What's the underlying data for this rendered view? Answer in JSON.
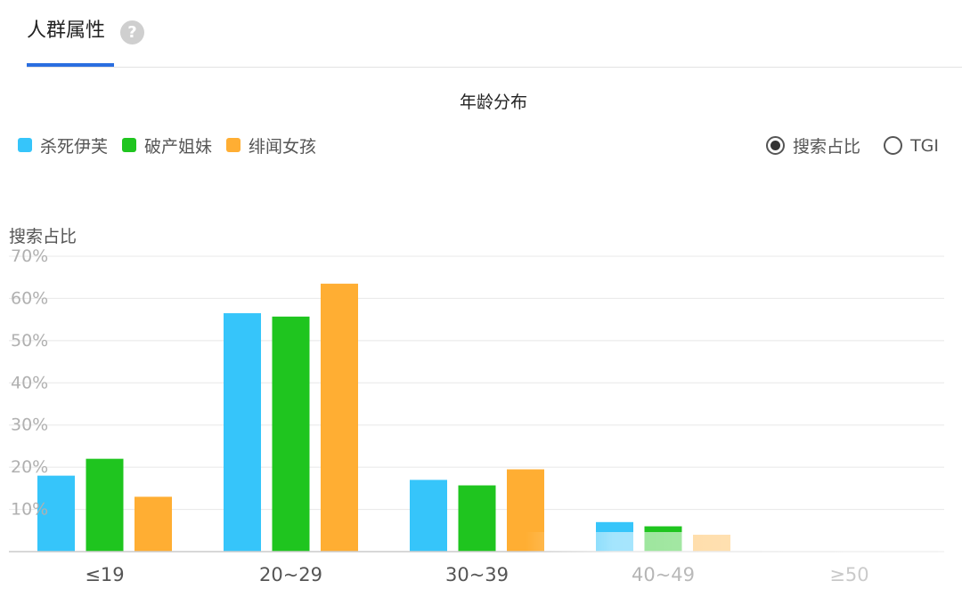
{
  "tab": {
    "title": "人群属性",
    "help_glyph": "?"
  },
  "legend": [
    {
      "label": "杀死伊芙",
      "color": "#36c5fa"
    },
    {
      "label": "破产姐妹",
      "color": "#1fc51f"
    },
    {
      "label": "绯闻女孩",
      "color": "#ffae33"
    }
  ],
  "toggle": {
    "options": [
      {
        "label": "搜索占比",
        "selected": true
      },
      {
        "label": "TGI",
        "selected": false
      }
    ]
  },
  "chart_data": {
    "type": "bar",
    "title": "年龄分布",
    "ylabel": "搜索占比",
    "xlabel": "",
    "ylim": [
      0,
      70
    ],
    "yticks": [
      "10%",
      "20%",
      "30%",
      "40%",
      "50%",
      "60%",
      "70%"
    ],
    "categories": [
      "≤19",
      "20~29",
      "30~39",
      "40~49",
      "≥50"
    ],
    "grid": true,
    "legend_position": "top-left",
    "series": [
      {
        "name": "杀死伊芙",
        "color": "#36c5fa",
        "values": [
          18,
          56.5,
          17,
          7,
          0
        ]
      },
      {
        "name": "破产姐妹",
        "color": "#1fc51f",
        "values": [
          22,
          55.7,
          15.7,
          6,
          0
        ]
      },
      {
        "name": "绯闻女孩",
        "color": "#ffae33",
        "values": [
          13,
          63.5,
          19.5,
          4,
          0
        ]
      }
    ]
  }
}
